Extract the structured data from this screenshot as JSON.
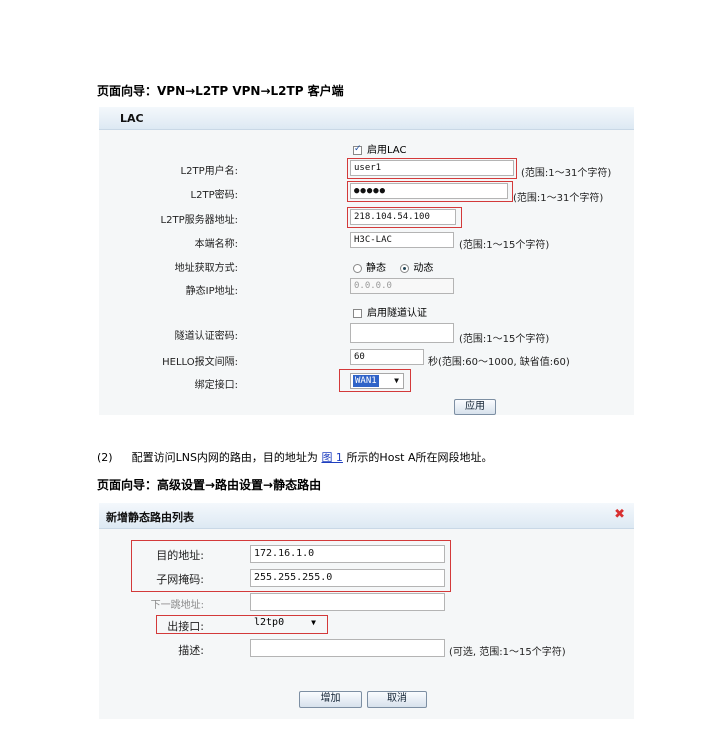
{
  "nav1": "页面向导：VPN→L2TP VPN→L2TP 客户端",
  "lac_panel": {
    "title": "LAC",
    "enable_lac_label": "启用LAC",
    "enable_lac_checked": true,
    "fields": {
      "username_label": "L2TP用户名:",
      "username_value": "user1",
      "username_hint": "(范围:1～31个字符)",
      "password_label": "L2TP密码:",
      "password_value": "●●●●●",
      "password_hint": "(范围:1～31个字符)",
      "server_label": "L2TP服务器地址:",
      "server_value": "218.104.54.100",
      "localname_label": "本端名称:",
      "localname_value": "H3C-LAC",
      "localname_hint": "(范围:1～15个字符)",
      "addrmode_label": "地址获取方式:",
      "addrmode_static": "静态",
      "addrmode_dynamic": "动态",
      "addrmode_selected": "动态",
      "staticip_label": "静态IP地址:",
      "staticip_value": "0.0.0.0",
      "tunnel_auth_label": "启用隧道认证",
      "tunnel_auth_checked": false,
      "tunnel_pwd_label": "隧道认证密码:",
      "tunnel_pwd_value": "",
      "tunnel_pwd_hint": "(范围:1～15个字符)",
      "hello_label": "HELLO报文间隔:",
      "hello_value": "60",
      "hello_hint": "秒(范围:60～1000, 缺省值:60)",
      "bind_label": "绑定接口:",
      "bind_value": "WAN1"
    },
    "apply_button": "应用"
  },
  "step_text": {
    "num": "(2)",
    "before": "配置访问LNS内网的路由，目的地址为",
    "link": "图 1",
    "after": "所示的Host A所在网段地址。"
  },
  "nav2": "页面向导：高级设置→路由设置→静态路由",
  "route_panel": {
    "title": "新增静态路由列表",
    "dest_label": "目的地址:",
    "dest_value": "172.16.1.0",
    "mask_label": "子网掩码:",
    "mask_value": "255.255.255.0",
    "nexthop_label": "下一跳地址:",
    "nexthop_value": "",
    "outif_label": "出接口:",
    "outif_value": "l2tp0",
    "desc_label": "描述:",
    "desc_value": "",
    "desc_hint": "(可选, 范围:1～15个字符)",
    "add_button": "增加",
    "cancel_button": "取消"
  },
  "colors": {
    "highlight_border": "#d33a3a",
    "panel_head": "#dde9f3",
    "close_icon": "#d83030",
    "link": "#1f3fbf"
  }
}
